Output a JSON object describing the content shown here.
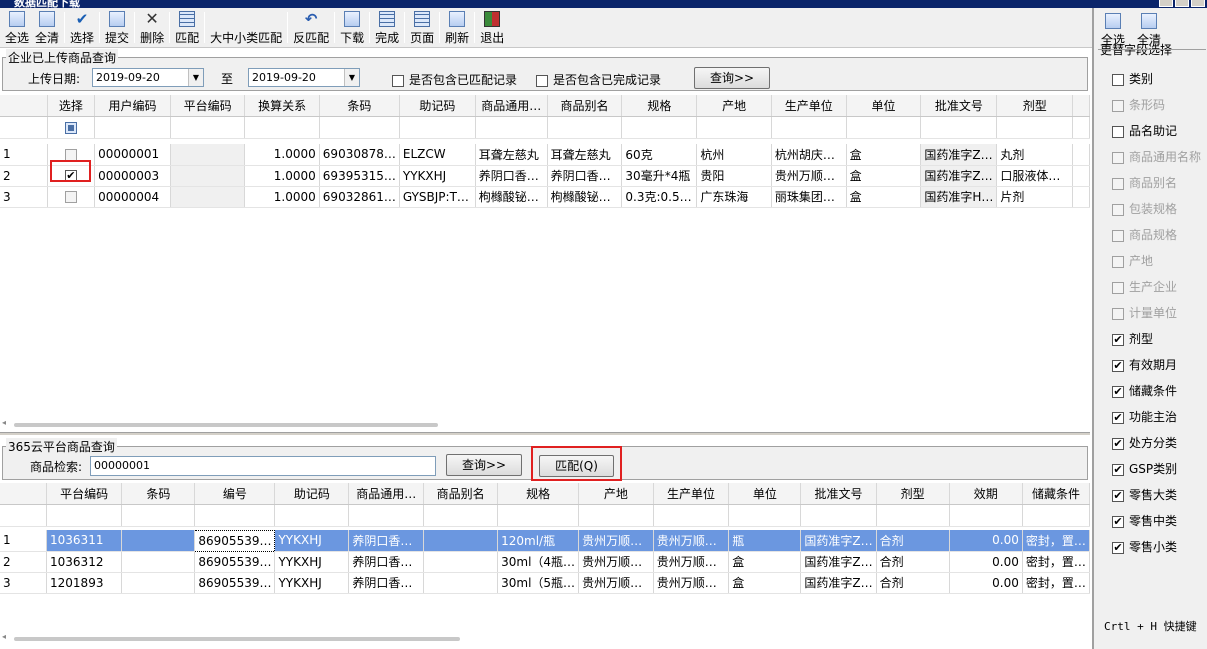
{
  "window_title": "数据匹配下载",
  "toolbar": {
    "select_all": "全选",
    "clear_all": "全清",
    "select": "选择",
    "submit": "提交",
    "delete": "删除",
    "match": "匹配",
    "category_match": "大中小类匹配",
    "unmatch": "反匹配",
    "download": "下载",
    "finish": "完成",
    "page": "页面",
    "refresh": "刷新",
    "exit": "退出"
  },
  "upload_query": {
    "legend": "企业已上传商品查询",
    "date_label": "上传日期:",
    "date_from": "2019-09-20",
    "to_label": "至",
    "date_to": "2019-09-20",
    "include_matched": "是否包含已匹配记录",
    "include_finished": "是否包含已完成记录",
    "query_button": "查询>>"
  },
  "upper_grid": {
    "headers": [
      "选择",
      "用户编码",
      "平台编码",
      "换算关系",
      "条码",
      "助记码",
      "商品通用…",
      "商品别名",
      "规格",
      "产地",
      "生产单位",
      "单位",
      "批准文号",
      "剂型"
    ],
    "rows": [
      {
        "idx": "1",
        "checked": false,
        "user_code": "00000001",
        "platform_code": "",
        "ratio": "1.0000",
        "barcode": "69030878…",
        "mnemonic": "ELZCW",
        "generic": "耳聋左慈丸",
        "alias": "耳聋左慈丸",
        "spec": "60克",
        "origin": "杭州",
        "maker": "杭州胡庆…",
        "unit": "盒",
        "approval": "国药准字Z…",
        "form": "丸剂"
      },
      {
        "idx": "2",
        "checked": true,
        "user_code": "00000003",
        "platform_code": "",
        "ratio": "1.0000",
        "barcode": "69395315…",
        "mnemonic": "YYKXHJ",
        "generic": "养阴口香…",
        "alias": "养阴口香…",
        "spec": "30毫升*4瓶",
        "origin": "贵阳",
        "maker": "贵州万顺…",
        "unit": "盒",
        "approval": "国药准字Z…",
        "form": "口服液体…"
      },
      {
        "idx": "3",
        "checked": false,
        "user_code": "00000004",
        "platform_code": "",
        "ratio": "1.0000",
        "barcode": "69032861…",
        "mnemonic": "GYSBJP:T…",
        "generic": "枸橼酸铋…",
        "alias": "枸橼酸铋…",
        "spec": "0.3克:0.5…",
        "origin": "广东珠海",
        "maker": "丽珠集团…",
        "unit": "盒",
        "approval": "国药准字H…",
        "form": "片剂"
      }
    ]
  },
  "platform_query": {
    "legend": "365云平台商品查询",
    "search_label": "商品检索:",
    "search_value": "00000001",
    "query_button": "查询>>",
    "match_button": "匹配(Q)"
  },
  "lower_grid": {
    "headers": [
      "平台编码",
      "条码",
      "编号",
      "助记码",
      "商品通用…",
      "商品别名",
      "规格",
      "产地",
      "生产单位",
      "单位",
      "批准文号",
      "剂型",
      "效期",
      "储藏条件"
    ],
    "rows": [
      {
        "idx": "1",
        "code": "1036311",
        "barcode": "",
        "number": "86905539…",
        "mnemonic": "YYKXHJ",
        "generic": "养阴口香…",
        "alias": "",
        "spec": "120ml/瓶",
        "origin": "贵州万顺…",
        "maker": "贵州万顺…",
        "unit": "瓶",
        "approval": "国药准字Z…",
        "form": "合剂",
        "expiry": "0.00",
        "storage": "密封，置…"
      },
      {
        "idx": "2",
        "code": "1036312",
        "barcode": "",
        "number": "86905539…",
        "mnemonic": "YYKXHJ",
        "generic": "养阴口香…",
        "alias": "",
        "spec": "30ml（4瓶…",
        "origin": "贵州万顺…",
        "maker": "贵州万顺…",
        "unit": "盒",
        "approval": "国药准字Z…",
        "form": "合剂",
        "expiry": "0.00",
        "storage": "密封，置…"
      },
      {
        "idx": "3",
        "code": "1201893",
        "barcode": "",
        "number": "86905539…",
        "mnemonic": "YYKXHJ",
        "generic": "养阴口香…",
        "alias": "",
        "spec": "30ml（5瓶…",
        "origin": "贵州万顺…",
        "maker": "贵州万顺…",
        "unit": "盒",
        "approval": "国药准字Z…",
        "form": "合剂",
        "expiry": "0.00",
        "storage": "密封，置…"
      }
    ]
  },
  "right_panel": {
    "select_all": "全选",
    "clear_all": "全清",
    "legend": "更替字段选择",
    "options": [
      {
        "label": "类别",
        "checked": false,
        "disabled": false
      },
      {
        "label": "条形码",
        "checked": false,
        "disabled": true
      },
      {
        "label": "品名助记",
        "checked": false,
        "disabled": false
      },
      {
        "label": "商品通用名称",
        "checked": false,
        "disabled": true
      },
      {
        "label": "商品别名",
        "checked": false,
        "disabled": true
      },
      {
        "label": "包装规格",
        "checked": false,
        "disabled": true
      },
      {
        "label": "商品规格",
        "checked": false,
        "disabled": true
      },
      {
        "label": "产地",
        "checked": false,
        "disabled": true
      },
      {
        "label": "生产企业",
        "checked": false,
        "disabled": true
      },
      {
        "label": "计量单位",
        "checked": false,
        "disabled": true
      },
      {
        "label": "剂型",
        "checked": true,
        "disabled": false
      },
      {
        "label": "有效期月",
        "checked": true,
        "disabled": false
      },
      {
        "label": "储藏条件",
        "checked": true,
        "disabled": false
      },
      {
        "label": "功能主治",
        "checked": true,
        "disabled": false
      },
      {
        "label": "处方分类",
        "checked": true,
        "disabled": false
      },
      {
        "label": "GSP类别",
        "checked": true,
        "disabled": false
      },
      {
        "label": "零售大类",
        "checked": true,
        "disabled": false
      },
      {
        "label": "零售中类",
        "checked": true,
        "disabled": false
      },
      {
        "label": "零售小类",
        "checked": true,
        "disabled": false
      }
    ],
    "shortcut": "Crtl + H 快捷键"
  }
}
